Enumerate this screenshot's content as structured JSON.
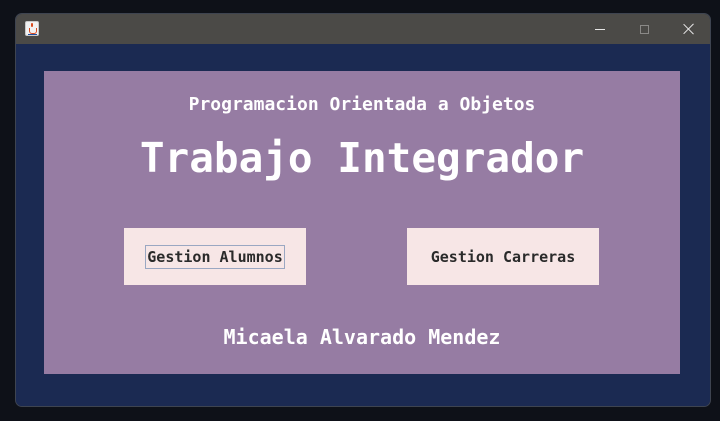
{
  "window": {
    "icon": "java-cup-icon",
    "controls": {
      "minimize": "minimize-icon",
      "maximize": "maximize-icon",
      "close": "close-icon"
    }
  },
  "main": {
    "subtitle": "Programacion Orientada a Objetos",
    "title": "Trabajo Integrador",
    "buttons": {
      "alumnos": "Gestion Alumnos",
      "carreras": "Gestion Carreras"
    },
    "author": "Micaela Alvarado Mendez"
  },
  "colors": {
    "window_background": "#1b2a52",
    "panel_background": "#967ca3",
    "button_background": "#f7e6e6",
    "titlebar": "#4b4a47",
    "text_light": "#ffffff",
    "text_dark": "#2a2a2a"
  }
}
